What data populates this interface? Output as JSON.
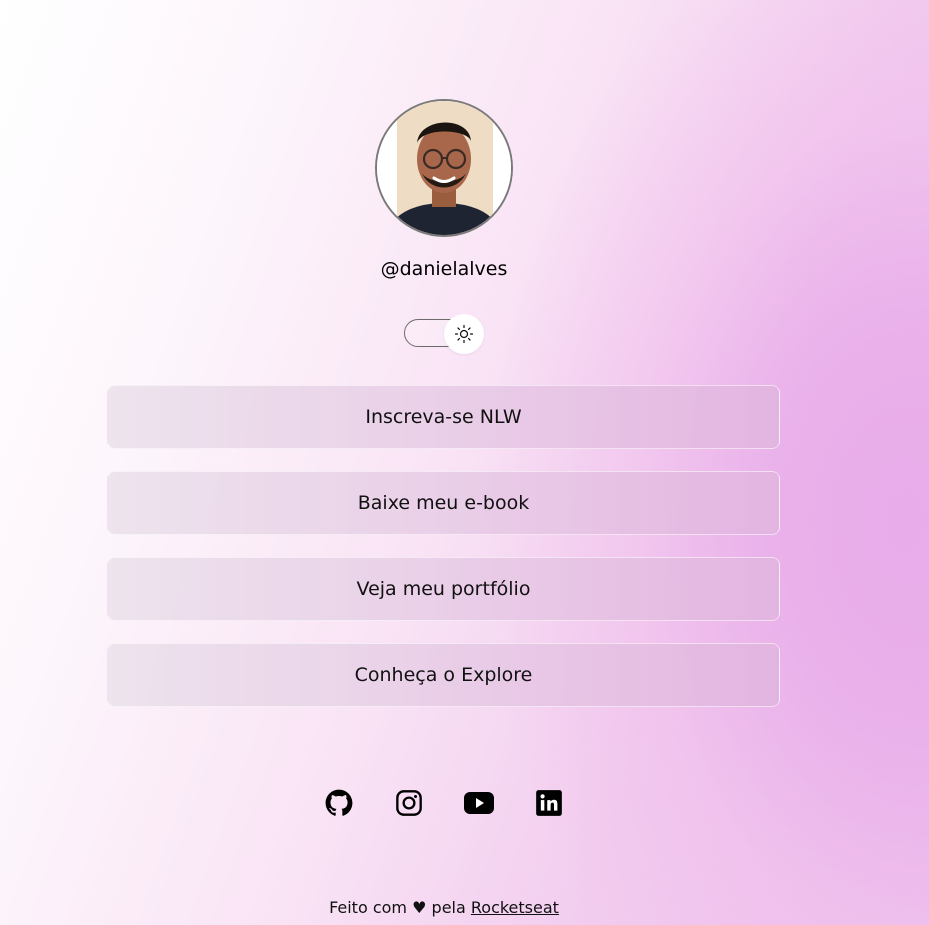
{
  "profile": {
    "username": "@danielalves"
  },
  "theme_toggle": {
    "mode": "light",
    "icon": "sun-icon"
  },
  "links": [
    {
      "label": "Inscreva-se NLW"
    },
    {
      "label": "Baixe meu e-book"
    },
    {
      "label": "Veja meu portfólio"
    },
    {
      "label": "Conheça o Explore"
    }
  ],
  "social": [
    {
      "icon": "github-icon"
    },
    {
      "icon": "instagram-icon"
    },
    {
      "icon": "youtube-icon"
    },
    {
      "icon": "linkedin-icon"
    }
  ],
  "footer": {
    "prefix": "Feito com",
    "heart": "♥",
    "middle": "pela",
    "link": "Rocketseat"
  },
  "colors": {
    "accent": "#e8acea",
    "text": "#000000",
    "button_bg": "#e8d0e6"
  }
}
